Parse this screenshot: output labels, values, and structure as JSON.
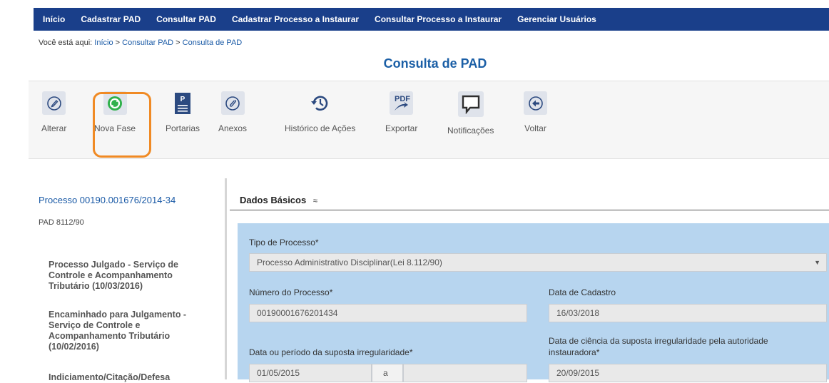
{
  "nav": [
    "Início",
    "Cadastrar PAD",
    "Consultar PAD",
    "Cadastrar Processo a Instaurar",
    "Consultar Processo a Instaurar",
    "Gerenciar Usuários"
  ],
  "breadcrumb": {
    "prefix": "Você está aqui:",
    "home": "Início",
    "sep1": ">",
    "consultar": "Consultar PAD",
    "sep2": ">",
    "current": "Consulta de PAD"
  },
  "page_title": "Consulta de PAD",
  "toolbar": [
    {
      "label": "Alterar",
      "icon": "edit-icon"
    },
    {
      "label": "Nova Fase",
      "icon": "refresh-icon"
    },
    {
      "label": "Portarias",
      "icon": "document-icon"
    },
    {
      "label": "Anexos",
      "icon": "attachment-icon"
    },
    {
      "label": "Histórico de Ações",
      "icon": "history-icon"
    },
    {
      "label": "Exportar",
      "icon": "pdf-icon"
    },
    {
      "label": "Notificações",
      "icon": "notification-icon"
    },
    {
      "label": "Voltar",
      "icon": "back-icon"
    }
  ],
  "sidebar": {
    "process": "Processo 00190.001676/2014-34",
    "type": "PAD 8112/90",
    "phases": [
      "Processo Julgado - Serviço de Controle e Acompanhamento Tributário (10/03/2016)",
      "Encaminhado para Julgamento - Serviço de Controle e Acompanhamento Tributário (10/02/2016)",
      "Indiciamento/Citação/Defesa"
    ]
  },
  "section": {
    "title": "Dados Básicos",
    "collapse_glyph": "≈"
  },
  "form": {
    "tipo_label": "Tipo de Processo*",
    "tipo_value": "Processo Administrativo Disciplinar(Lei 8.112/90)",
    "numero_label": "Número do Processo*",
    "numero_value": "00190001676201434",
    "data_cadastro_label": "Data de Cadastro",
    "data_cadastro_value": "16/03/2018",
    "periodo_label": "Data ou período da suposta irregularidade*",
    "periodo_inicio": "01/05/2015",
    "periodo_sep": "a",
    "periodo_fim": "",
    "ciencia_label_1": "Data de ciência da suposta irregularidade pela autoridade",
    "ciencia_label_2": "instauradora*",
    "ciencia_value": "20/09/2015"
  },
  "colors": {
    "nav_bg": "#1a3f8a",
    "link": "#1a5aa6",
    "title": "#1b5fa6",
    "highlight": "#f08a24",
    "panel": "#b7d5ef"
  }
}
